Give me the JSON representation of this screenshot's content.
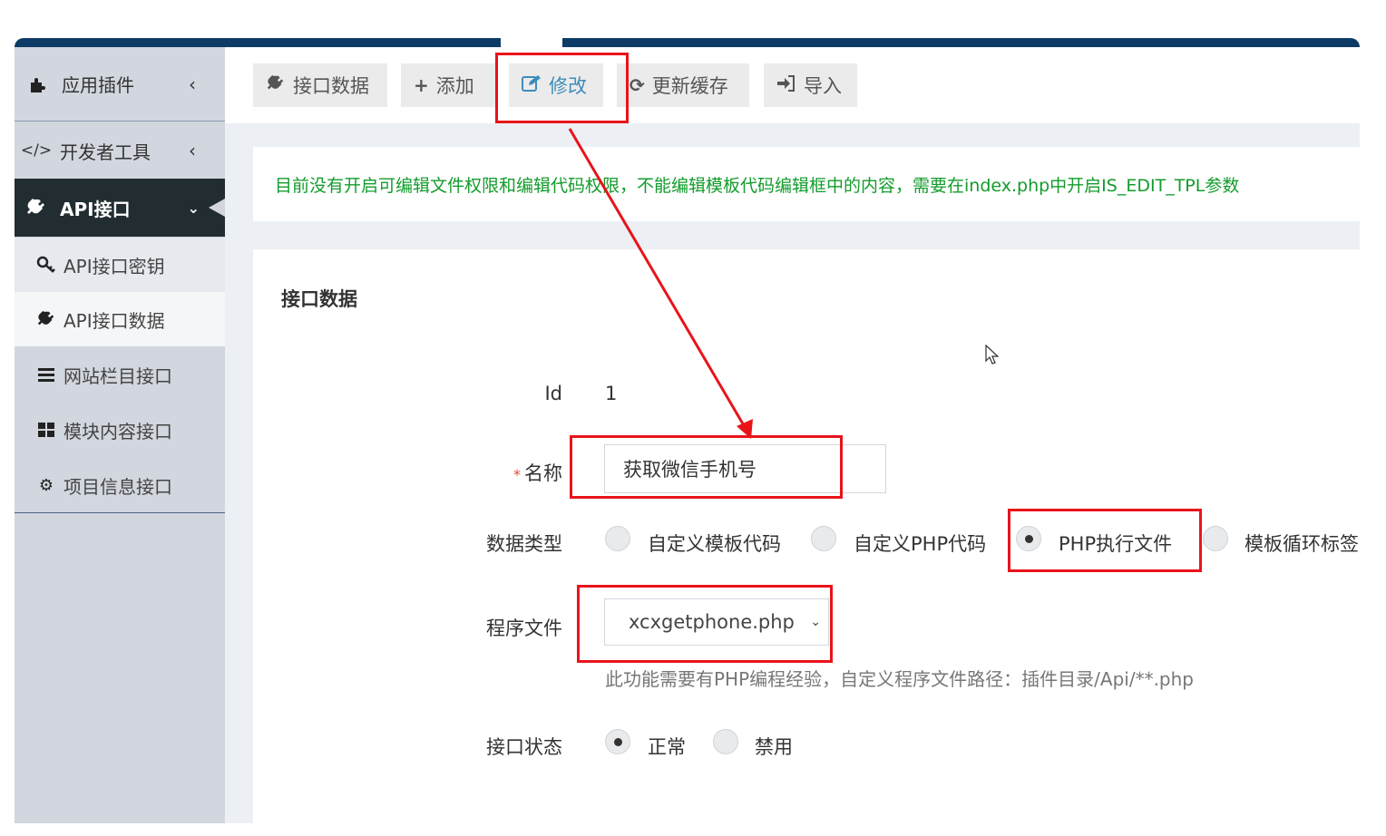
{
  "sidebar": {
    "plugin": {
      "label": "应用插件",
      "icon": "puzzle-icon"
    },
    "dev": {
      "label": "开发者工具",
      "icon": "code-icon"
    },
    "api": {
      "label": "API接口",
      "icon": "plug-icon"
    },
    "sub": [
      {
        "label": "API接口密钥",
        "icon": "key-icon"
      },
      {
        "label": "API接口数据",
        "icon": "plug-icon"
      },
      {
        "label": "网站栏目接口",
        "icon": "bars-icon"
      },
      {
        "label": "模块内容接口",
        "icon": "grid-icon"
      },
      {
        "label": "项目信息接口",
        "icon": "gear-icon"
      }
    ]
  },
  "toolbar": {
    "data": "接口数据",
    "add": "添加",
    "edit": "修改",
    "cache": "更新缓存",
    "import": "导入"
  },
  "notice": "目前没有开启可编辑文件权限和编辑代码权限，不能编辑模板代码编辑框中的内容，需要在index.php中开启IS_EDIT_TPL参数",
  "panel": {
    "title": "接口数据"
  },
  "form": {
    "id_label": "Id",
    "id_value": "1",
    "name_label": "名称",
    "name_value": "获取微信手机号",
    "type_label": "数据类型",
    "type_options": [
      "自定义模板代码",
      "自定义PHP代码",
      "PHP执行文件",
      "模板循环标签"
    ],
    "type_selected": "PHP执行文件",
    "file_label": "程序文件",
    "file_value": "xcxgetphone.php",
    "file_help": "此功能需要有PHP编程经验，自定义程序文件路径：插件目录/Api/**.php",
    "status_label": "接口状态",
    "status_options": [
      "正常",
      "禁用"
    ],
    "status_selected": "正常"
  },
  "colors": {
    "accent": "#3c8dbc",
    "annotation": "#e8141a",
    "notice": "#139c2c",
    "nav": "#0d3b66"
  }
}
